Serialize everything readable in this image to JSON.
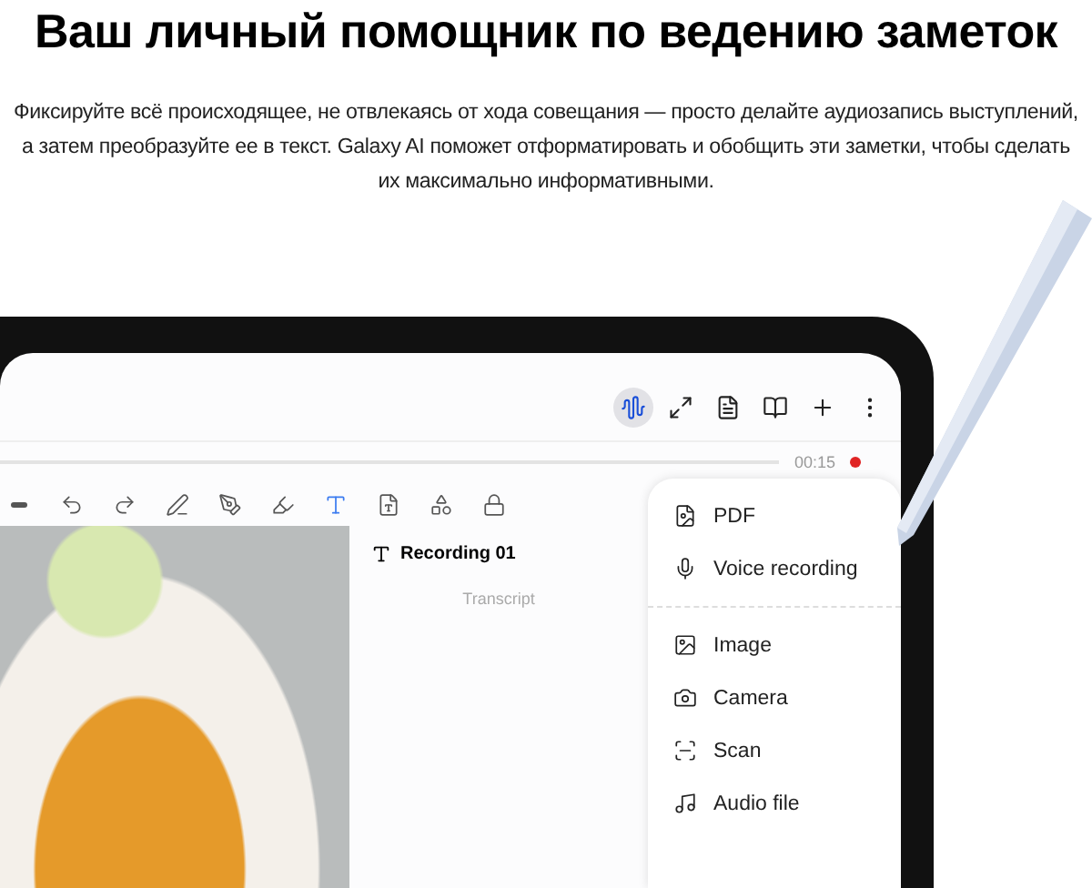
{
  "heading": "Ваш личный помощник по ведению заметок",
  "description": "Фиксируйте всё происходящее, не отвлекаясь от хода совещания — просто делайте аудиозапись выступлений, а затем преобразуйте ее в текст. Galaxy AI поможет отформатировать и обобщить эти заметки, чтобы сделать их максимально информативными.",
  "tablet": {
    "top_toolbar": [
      {
        "selected": true
      },
      {
        "selected": false
      },
      {
        "selected": false
      },
      {
        "selected": false
      },
      {
        "selected": false
      },
      {
        "selected": false
      }
    ],
    "timeline": {
      "time": "00:15"
    },
    "pen_toolbar": [
      {
        "selected": false
      },
      {
        "selected": false
      },
      {
        "selected": false
      },
      {
        "selected": false
      },
      {
        "selected": false
      },
      {
        "selected": false
      },
      {
        "selected": true
      },
      {
        "selected": false
      },
      {
        "selected": false
      },
      {
        "selected": false
      }
    ],
    "note": {
      "title": "Recording 01",
      "placeholder": "Transcript"
    },
    "insert_menu": {
      "groups": [
        [
          {
            "label": "PDF"
          },
          {
            "label": "Voice recording"
          }
        ],
        [
          {
            "label": "Image"
          },
          {
            "label": "Camera"
          },
          {
            "label": "Scan"
          },
          {
            "label": "Audio file"
          }
        ]
      ]
    }
  }
}
